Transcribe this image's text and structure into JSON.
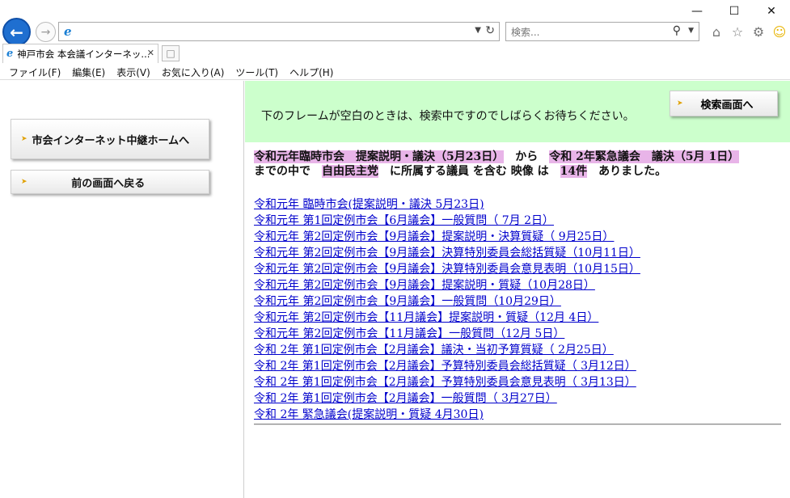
{
  "browser": {
    "search_placeholder": "検索...",
    "tab_title": "神戸市会 本会議インターネッ...",
    "menu": [
      "ファイル(F)",
      "編集(E)",
      "表示(V)",
      "お気に入り(A)",
      "ツール(T)",
      "ヘルプ(H)"
    ]
  },
  "left": {
    "home_button": "市会インターネット中継ホームへ",
    "back_button": "前の画面へ戻る"
  },
  "right": {
    "notice": "下のフレームが空白のときは、検索中ですのでしばらくお待ちください。",
    "search_screen_button": "検索画面へ",
    "summary": {
      "from": "令和元年臨時市会　提案説明・議決（5月23日）",
      "from_suffix": "から",
      "to": "令和 2年緊急議会　議決（5月 1日）",
      "line2_prefix": "までの中で",
      "party": "自由民主党",
      "line2_mid": "に所属する議員 を含む 映像 は",
      "count": "14件",
      "line2_suffix": "ありました。"
    },
    "results": [
      "令和元年 臨時市会(提案説明・議決 5月23日)",
      "令和元年 第1回定例市会【6月議会】一般質問（ 7月 2日）",
      "令和元年 第2回定例市会【9月議会】提案説明・決算質疑（ 9月25日）",
      "令和元年 第2回定例市会【9月議会】決算特別委員会総括質疑（10月11日）",
      "令和元年 第2回定例市会【9月議会】決算特別委員会意見表明（10月15日）",
      "令和元年 第2回定例市会【9月議会】提案説明・質疑（10月28日）",
      "令和元年 第2回定例市会【9月議会】一般質問（10月29日）",
      "令和元年 第2回定例市会【11月議会】提案説明・質疑（12月 4日）",
      "令和元年 第2回定例市会【11月議会】一般質問（12月 5日）",
      "令和 2年 第1回定例市会【2月議会】議決・当初予算質疑（ 2月25日）",
      "令和 2年 第1回定例市会【2月議会】予算特別委員会総括質疑（ 3月12日）",
      "令和 2年 第1回定例市会【2月議会】予算特別委員会意見表明（ 3月13日）",
      "令和 2年 第1回定例市会【2月議会】一般質問（ 3月27日）",
      "令和 2年 緊急議会(提案説明・質疑 4月30日)"
    ]
  }
}
